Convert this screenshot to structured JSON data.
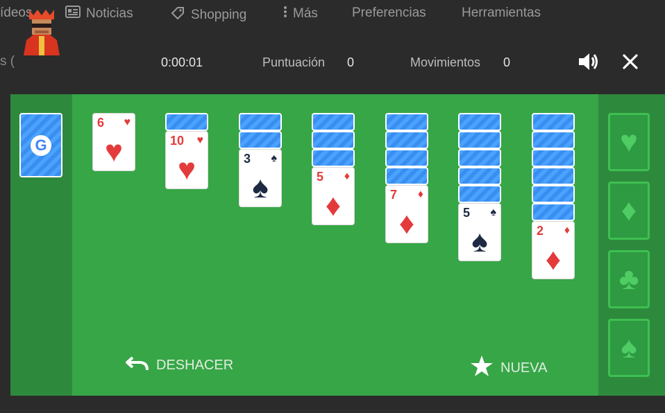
{
  "google_nav": {
    "videos": "ídeos",
    "noticias": "Noticias",
    "shopping": "Shopping",
    "mas": "Más",
    "preferencias": "Preferencias",
    "herramientas": "Herramientas"
  },
  "bg_left_text": "s (",
  "hud": {
    "timer": "0:00:01",
    "score_label": "Puntuación",
    "score_value": "0",
    "moves_label": "Movimientos",
    "moves_value": "0"
  },
  "stock": {
    "logo": "G"
  },
  "tableau": [
    {
      "face_down": 0,
      "rank": "6",
      "suit": "♥",
      "color": "red"
    },
    {
      "face_down": 1,
      "rank": "10",
      "suit": "♥",
      "color": "red"
    },
    {
      "face_down": 2,
      "rank": "3",
      "suit": "♠",
      "color": "dark"
    },
    {
      "face_down": 3,
      "rank": "5",
      "suit": "♦",
      "color": "red"
    },
    {
      "face_down": 4,
      "rank": "7",
      "suit": "♦",
      "color": "red"
    },
    {
      "face_down": 5,
      "rank": "5",
      "suit": "♠",
      "color": "dark"
    },
    {
      "face_down": 6,
      "rank": "2",
      "suit": "♦",
      "color": "red"
    }
  ],
  "foundations": [
    "♥",
    "♦",
    "♣",
    "♠"
  ],
  "buttons": {
    "undo": "DESHACER",
    "new": "NUEVA"
  }
}
